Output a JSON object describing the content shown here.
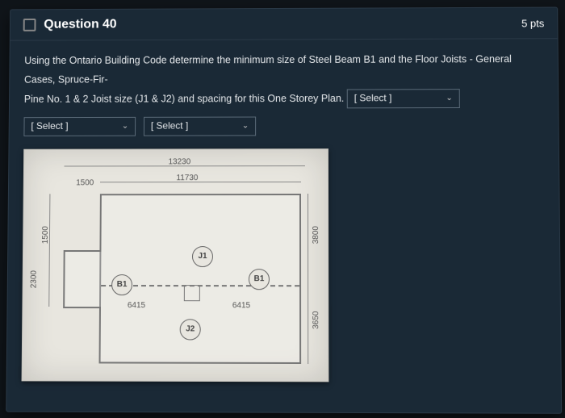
{
  "header": {
    "question_number": "Question 40",
    "points": "5 pts"
  },
  "prompt": {
    "line1": "Using the Ontario Building Code determine the minimum size of Steel Beam B1 and the Floor Joists - General Cases, Spruce-Fir-",
    "line2_prefix": "Pine No. 1 & 2 Joist size (J1 & J2) and spacing for this One Storey Plan."
  },
  "select_placeholder": "[ Select ]",
  "plan": {
    "dim_top_outer": "13230",
    "dim_top_inner": "11730",
    "dim_top_left": "1500",
    "dim_left_lower": "2300",
    "dim_left_upper": "1500",
    "dim_bottom_left": "6415",
    "dim_bottom_right": "6415",
    "dim_right_upper": "3800",
    "dim_right_lower": "3650",
    "label_B1": "B1",
    "label_J1": "J1",
    "label_J2": "J2"
  }
}
